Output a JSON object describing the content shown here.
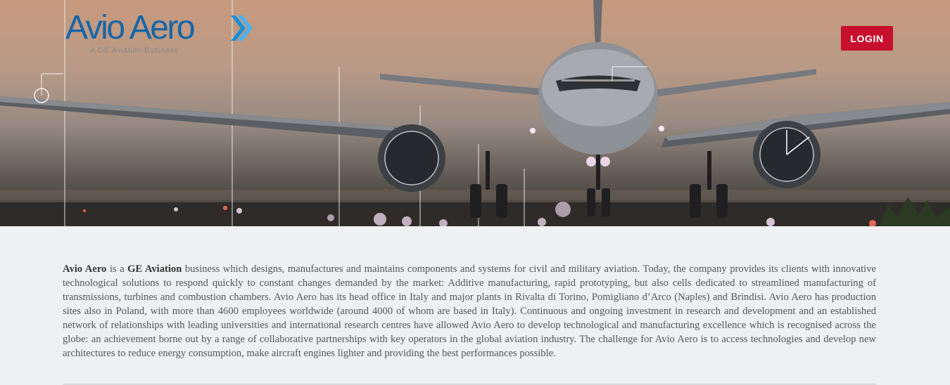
{
  "header": {
    "logo": {
      "brand": "Avio Aero",
      "tagline": "A GE Aviation Business"
    },
    "login_label": "LOGIN"
  },
  "hero": {
    "image": "jet-airliner-runway-with-engineering-formula-overlays"
  },
  "about": {
    "company": "Avio Aero",
    "text_1": " is a ",
    "parent": "GE Aviation",
    "text_2": " business which designs, manufactures and maintains components and systems for civil and military aviation. Today, the company provides its clients with innovative technological solutions to respond quickly to constant changes demanded by the market: Additive manufacturing, rapid prototyping, but also cells dedicated to streamlined manufacturing of transmissions, turbines and combustion chambers. Avio Aero has its head office in Italy and major plants in Rivalta di Torino, Pomigliano d’Arco (Naples) and Brindisi. Avio Aero has production sites also in Poland, with more than 4600 employees worldwide (around 4000 of whom are based in Italy). Continuous and ongoing investment in research and development and an established network of relationships with leading universities and international research centres have allowed Avio Aero to develop technological and manufacturing excellence which is recognised across the globe: an achievement borne out by a range of collaborative partnerships with key operators in the global aviation industry. The challenge for Avio Aero is to access technologies and develop new architectures to reduce energy consumption, make aircraft engines lighter and providing the best performances possible."
  },
  "colors": {
    "brand_blue": "#1565a8",
    "login_red": "#c8102e",
    "page_bg": "#eff0f1",
    "text": "#555555"
  }
}
